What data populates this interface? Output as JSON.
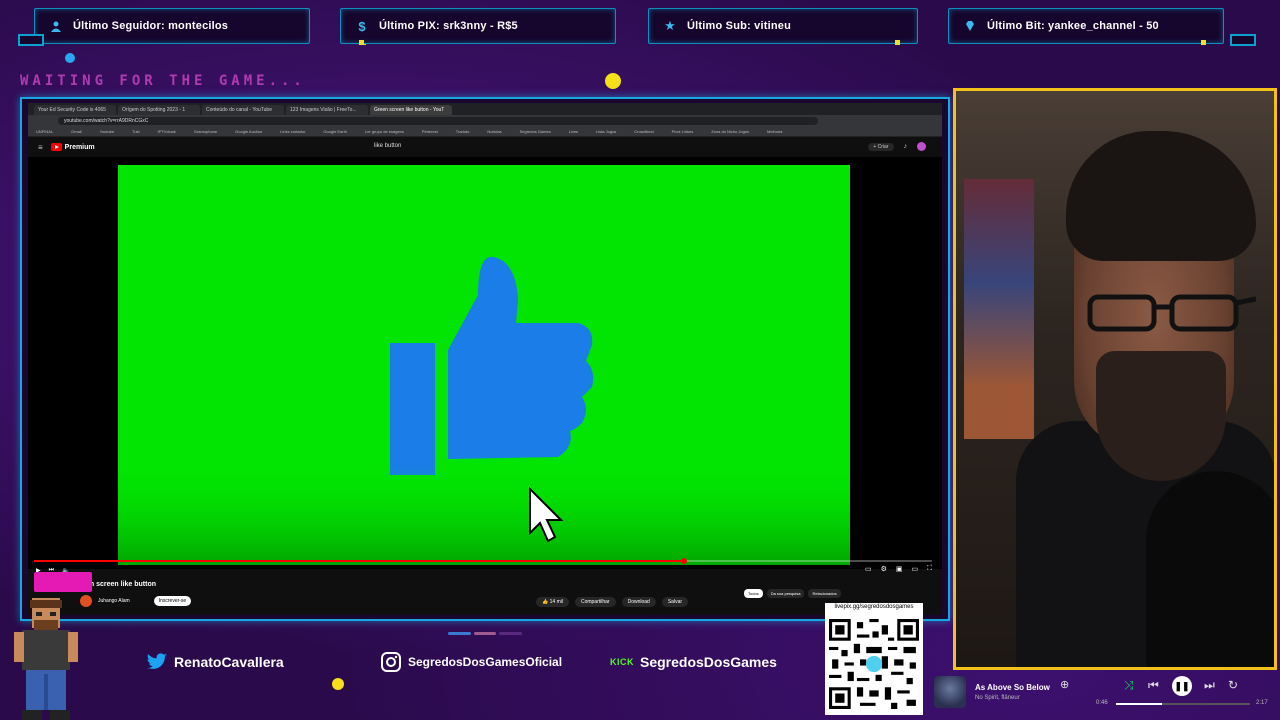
{
  "alerts": [
    {
      "icon": "user-icon",
      "label": "Último Seguidor: montecilos"
    },
    {
      "icon": "dollar-icon",
      "label": "Último PIX: srk3nny - R$5"
    },
    {
      "icon": "star-icon",
      "label": "Último Sub: vitineu"
    },
    {
      "icon": "diamond-icon",
      "label": "Último Bit: yankee_channel - 50"
    }
  ],
  "waiting_text": "WAITING FOR THE GAME...",
  "browser": {
    "tabs": [
      "Your Ed Security Code is 4065",
      "Orígem do Spotting 2023 - 1",
      "Conteúdo do canal - YouTube",
      "123 Imagens Visão | FreeTo...",
      "Green screen like button - YouT"
    ],
    "url": "youtube.com/watch?v=rrA9DRnCGxC",
    "bookmarks": [
      "UNFINAL",
      "Gmail",
      "Youtube",
      "Tukl",
      "IPTVcloak",
      "Gramophone",
      "Google Auction",
      "Links cortador",
      "Google Earth",
      "Ler grupo de imagens",
      "Pinterest",
      "Traduto",
      "Noticias",
      "Segredos Games",
      "Lives",
      "Lista Jogos",
      "Crowdfund",
      "Pivot Linkes",
      "Zona do Nicho Jogos",
      "Melhoria"
    ],
    "yt_logo": "Premium",
    "search_query": "like button",
    "create_label": "Criar",
    "video_title": "en screen like button",
    "channel_name": "Juhango Alam",
    "subscribe_label": "Inscrever-se",
    "actions": [
      "14 mil",
      "Compartilhar",
      "Download",
      "Salvar"
    ],
    "chips": [
      "Todos",
      "Da sua pesquisa",
      "Relacionados"
    ],
    "progress": 0.72
  },
  "socials": [
    {
      "icon": "twitter-icon",
      "name": "RenatoCavallera"
    },
    {
      "icon": "instagram-icon",
      "name": "SegredosDosGamesOficial"
    },
    {
      "icon": "kick-icon",
      "name": "SegredosDosGames",
      "logo": "KICK"
    }
  ],
  "qr": {
    "url": "livepix.gg/segredosdosgames"
  },
  "music": {
    "song": "As Above So Below",
    "artist": "No Spirit, flâneur",
    "elapsed": "0:46",
    "duration": "2:17",
    "progress": 0.34
  },
  "colors": {
    "accent": "#1aa6e0",
    "cam_border": "#f3c21a",
    "green_screen": "#02e402",
    "like_blue": "#1a7de8"
  }
}
